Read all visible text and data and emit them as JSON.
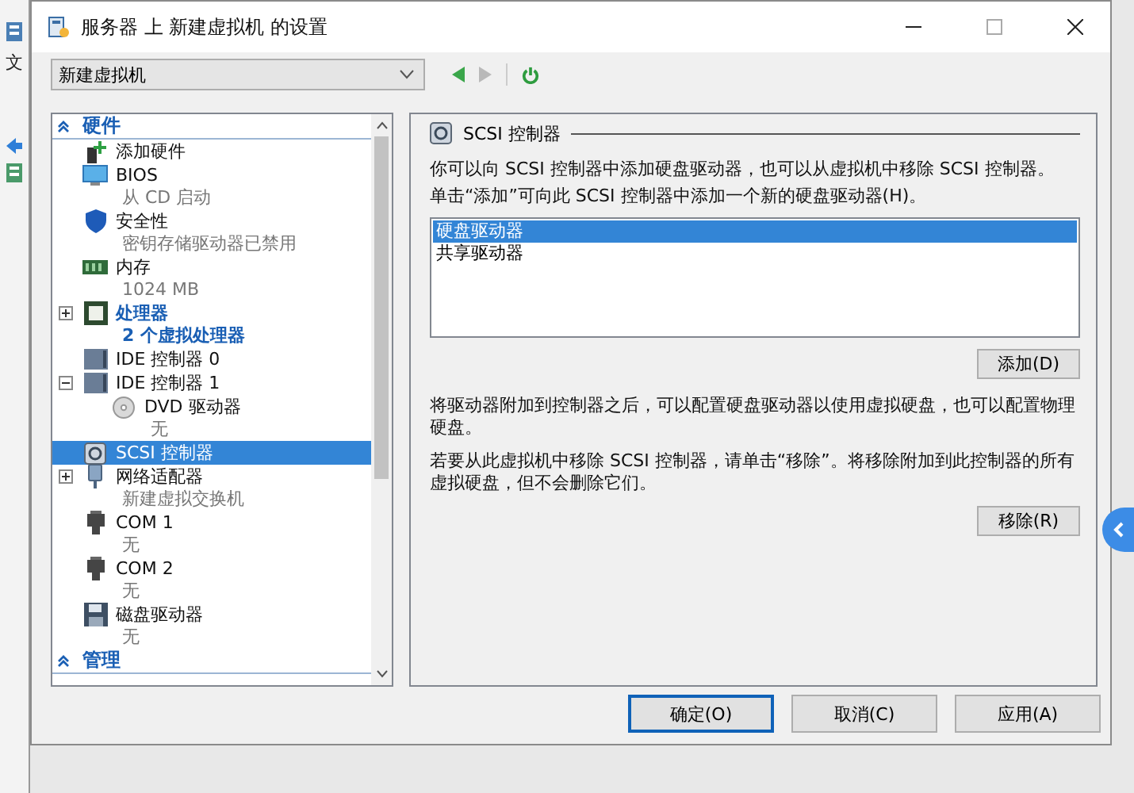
{
  "background_window": {
    "menu_text": "文"
  },
  "window": {
    "title": "服务器 上 新建虚拟机 的设置"
  },
  "toolbar": {
    "vm_select": "新建虚拟机"
  },
  "tree": {
    "sections": [
      {
        "label": "硬件",
        "expanded": true,
        "items": [
          {
            "kind": "add",
            "label": "添加硬件",
            "selected": false,
            "bold": false
          },
          {
            "kind": "bios",
            "label": "BIOS",
            "detail": "从 CD 启动",
            "selected": false,
            "bold": false
          },
          {
            "kind": "security",
            "label": "安全性",
            "detail": "密钥存储驱动器已禁用",
            "selected": false,
            "bold": false
          },
          {
            "kind": "memory",
            "label": "内存",
            "detail": "1024 MB",
            "selected": false,
            "bold": false
          },
          {
            "kind": "processor",
            "label": "处理器",
            "detail": "2 个虚拟处理器",
            "selected": false,
            "bold": true,
            "expanded": false
          },
          {
            "kind": "ide",
            "label": "IDE 控制器 0",
            "selected": false,
            "bold": false
          },
          {
            "kind": "ide",
            "label": "IDE 控制器 1",
            "selected": false,
            "bold": false,
            "expanded": true,
            "children": [
              {
                "kind": "dvd",
                "label": "DVD 驱动器",
                "detail": "无",
                "selected": false,
                "bold": false
              }
            ]
          },
          {
            "kind": "scsi",
            "label": "SCSI 控制器",
            "selected": true,
            "bold": false
          },
          {
            "kind": "network",
            "label": "网络适配器",
            "detail": "新建虚拟交换机",
            "selected": false,
            "bold": false,
            "expanded": false
          },
          {
            "kind": "com",
            "label": "COM 1",
            "detail": "无",
            "selected": false,
            "bold": false
          },
          {
            "kind": "com",
            "label": "COM 2",
            "detail": "无",
            "selected": false,
            "bold": false
          },
          {
            "kind": "floppy",
            "label": "磁盘驱动器",
            "detail": "无",
            "selected": false,
            "bold": false
          }
        ]
      },
      {
        "label": "管理",
        "expanded": true
      }
    ]
  },
  "panel": {
    "title": "SCSI 控制器",
    "intro": [
      "你可以向 SCSI 控制器中添加硬盘驱动器，也可以从虚拟机中移除 SCSI 控制器。",
      "单击“添加”可向此 SCSI 控制器中添加一个新的硬盘驱动器(H)。"
    ],
    "drive_types": [
      {
        "label": "硬盘驱动器",
        "selected": true
      },
      {
        "label": "共享驱动器",
        "selected": false
      }
    ],
    "add_button": "添加(D)",
    "notes": [
      "将驱动器附加到控制器之后，可以配置硬盘驱动器以使用虚拟硬盘，也可以配置物理硬盘。",
      "若要从此虚拟机中移除 SCSI 控制器，请单击“移除”。将移除附加到此控制器的所有虚拟硬盘，但不会删除它们。"
    ],
    "remove_button": "移除(R)"
  },
  "buttons": [
    {
      "label": "确定(O)",
      "default": true
    },
    {
      "label": "取消(C)",
      "default": false
    },
    {
      "label": "应用(A)",
      "default": false
    }
  ]
}
